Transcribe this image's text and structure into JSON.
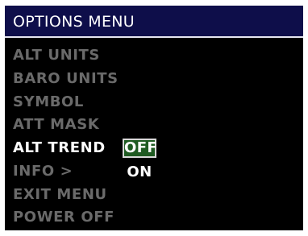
{
  "menu": {
    "title": "OPTIONS MENU",
    "items": [
      {
        "label": "ALT UNITS"
      },
      {
        "label": "BARO UNITS"
      },
      {
        "label": "SYMBOL"
      },
      {
        "label": "ATT MASK"
      },
      {
        "label": "ALT TREND"
      },
      {
        "label": "INFO >"
      },
      {
        "label": "EXIT MENU"
      },
      {
        "label": "POWER OFF"
      }
    ],
    "active_item": "ALT TREND",
    "submenu": {
      "options": [
        {
          "label": "OFF",
          "selected": true
        },
        {
          "label": "ON",
          "selected": false
        }
      ]
    }
  },
  "colors": {
    "background": "#000000",
    "title_bar": "#0e0e4a",
    "title_underline": "#e6e6f0",
    "inactive_text": "#6a6a6a",
    "active_text": "#ffffff",
    "selected_option_fill": "#1f5b22",
    "selected_option_border": "#d8d8d8"
  }
}
